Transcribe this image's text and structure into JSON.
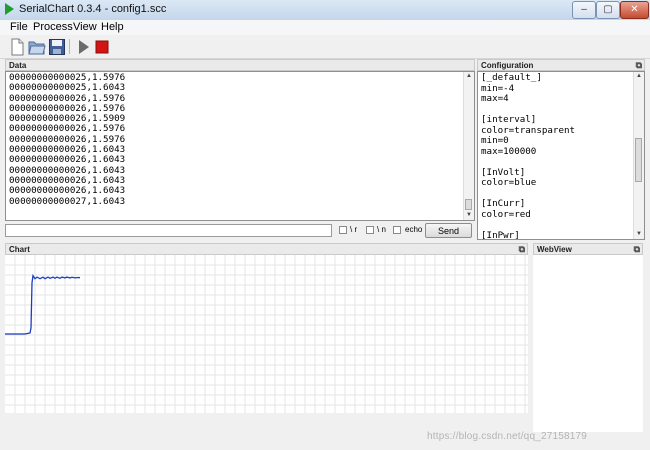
{
  "window": {
    "title": "SerialChart 0.3.4 - config1.scc"
  },
  "menu": [
    "File",
    "Process",
    "View",
    "Help"
  ],
  "toolbar": {
    "icons": [
      "new-file-icon",
      "open-folder-icon",
      "save-icon",
      "run-icon",
      "stop-icon"
    ]
  },
  "data_panel": {
    "title": "Data",
    "lines": [
      "00000000000025,1.5976",
      "00000000000025,1.6043",
      "00000000000026,1.5976",
      "00000000000026,1.5976",
      "00000000000026,1.5909",
      "00000000000026,1.5976",
      "00000000000026,1.5976",
      "00000000000026,1.6043",
      "00000000000026,1.6043",
      "00000000000026,1.6043",
      "00000000000026,1.6043",
      "00000000000026,1.6043",
      "00000000000027,1.6043"
    ]
  },
  "config_panel": {
    "title": "Configuration",
    "lines": [
      "[_default_]",
      "min=-4",
      "max=4",
      "",
      "[interval]",
      "color=transparent",
      "min=0",
      "max=100000",
      "",
      "[InVolt]",
      "color=blue",
      "",
      "[InCurr]",
      "color=red",
      "",
      "[InPwr]"
    ]
  },
  "send_bar": {
    "input_value": "",
    "options": [
      {
        "label": "\\ r",
        "checked": false
      },
      {
        "label": "\\ n",
        "checked": false
      },
      {
        "label": "echo",
        "checked": false
      }
    ],
    "send_label": "Send"
  },
  "chart_panel": {
    "title": "Chart"
  },
  "webview_panel": {
    "title": "WebView"
  },
  "float_icon": "⧉",
  "watermark": "https://blog.csdn.net/qq_27158179",
  "chart_data": {
    "type": "line",
    "series": [
      {
        "color": "#1a3bc8",
        "x": [
          0,
          20,
          25,
          26,
          27,
          28,
          30,
          32,
          35,
          38,
          40,
          43,
          45,
          48,
          50,
          52,
          55,
          57,
          60,
          62,
          65,
          67,
          70,
          73,
          75
        ],
        "y": [
          0.0,
          0.0,
          0.05,
          0.3,
          2.6,
          2.95,
          2.8,
          2.88,
          2.8,
          2.88,
          2.8,
          2.88,
          2.82,
          2.88,
          2.82,
          2.88,
          2.82,
          2.88,
          2.84,
          2.88,
          2.84,
          2.87,
          2.84,
          2.86,
          2.85
        ]
      }
    ],
    "xlim": [
      0,
      523
    ],
    "ylim": [
      -4,
      4
    ],
    "grid": true,
    "grid_color": "#e4e4e4"
  }
}
